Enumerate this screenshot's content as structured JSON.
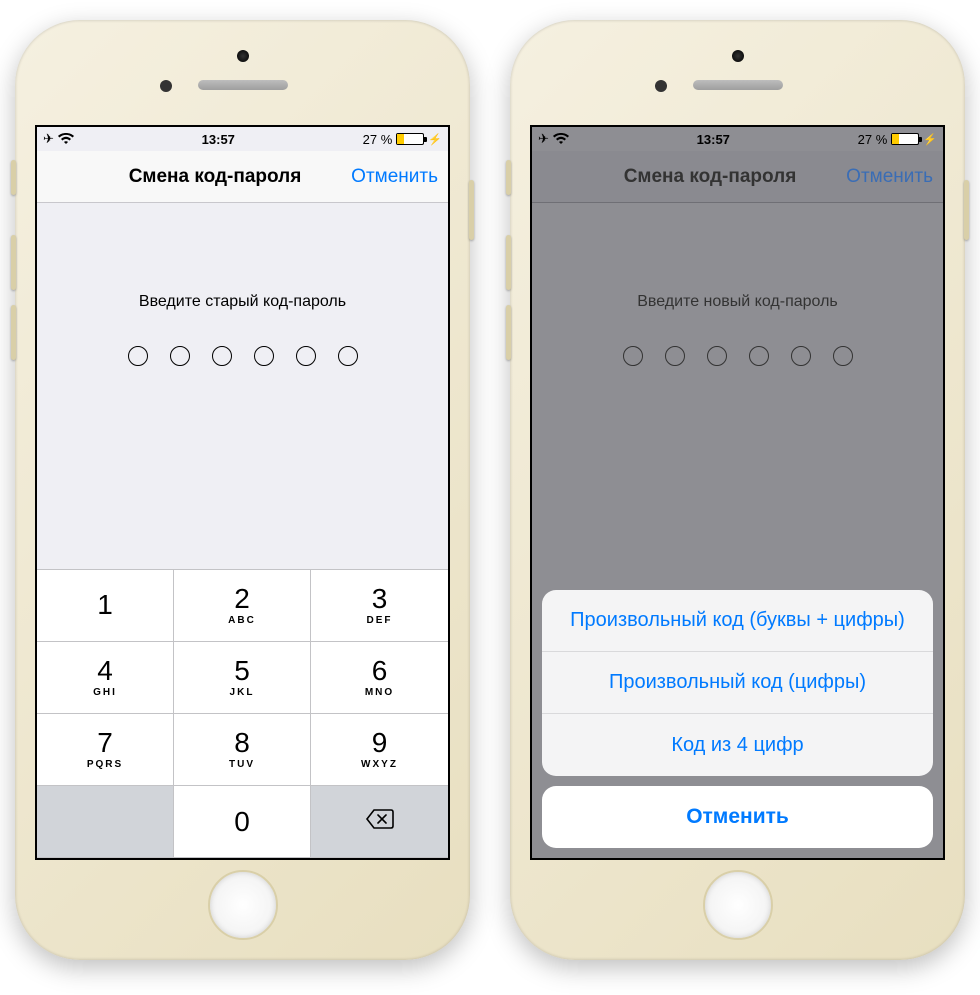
{
  "status": {
    "time": "13:57",
    "battery_pct": "27 %"
  },
  "nav": {
    "title": "Смена код-пароля",
    "cancel": "Отменить"
  },
  "left": {
    "prompt": "Введите старый код-пароль",
    "keys": [
      {
        "num": "1",
        "ltr": ""
      },
      {
        "num": "2",
        "ltr": "ABC"
      },
      {
        "num": "3",
        "ltr": "DEF"
      },
      {
        "num": "4",
        "ltr": "GHI"
      },
      {
        "num": "5",
        "ltr": "JKL"
      },
      {
        "num": "6",
        "ltr": "MNO"
      },
      {
        "num": "7",
        "ltr": "PQRS"
      },
      {
        "num": "8",
        "ltr": "TUV"
      },
      {
        "num": "9",
        "ltr": "WXYZ"
      },
      {
        "num": "0",
        "ltr": ""
      }
    ]
  },
  "right": {
    "prompt": "Введите новый код-пароль",
    "sheet": {
      "opt1": "Произвольный код (буквы + цифры)",
      "opt2": "Произвольный код (цифры)",
      "opt3": "Код из 4 цифр",
      "cancel": "Отменить"
    }
  }
}
